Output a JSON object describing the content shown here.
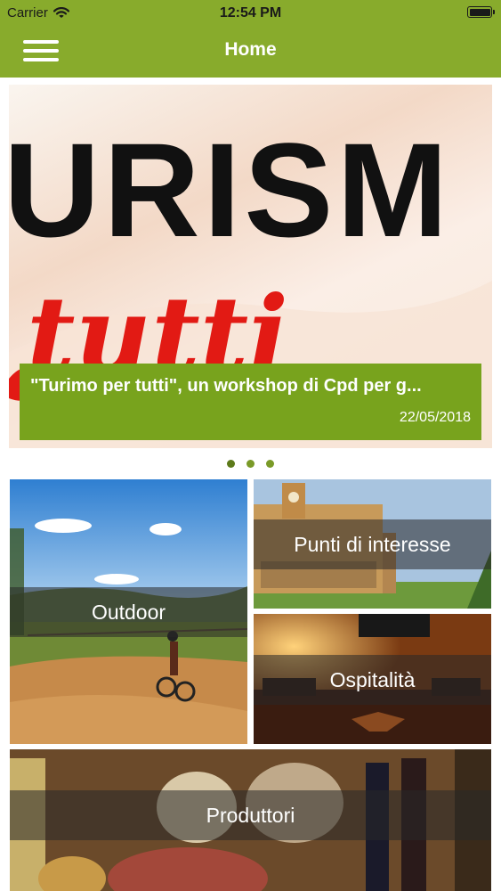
{
  "status": {
    "carrier": "Carrier",
    "time": "12:54 PM"
  },
  "nav": {
    "title": "Home"
  },
  "slider": {
    "image_text": "URISM",
    "image_script": "tutti",
    "caption_title": "\"Turimo per tutti\", un workshop di Cpd per g...",
    "caption_date": "22/05/2018",
    "page_count": 3,
    "current_page": 1
  },
  "tiles": {
    "outdoor": "Outdoor",
    "poi": "Punti di interesse",
    "hospitality": "Ospitalità",
    "producers": "Produttori"
  },
  "colors": {
    "brand_green": "#88ab2c",
    "caption_green": "#78a31d"
  },
  "icons": {
    "menu": "hamburger-menu-icon",
    "wifi": "wifi-icon",
    "battery": "battery-icon"
  }
}
